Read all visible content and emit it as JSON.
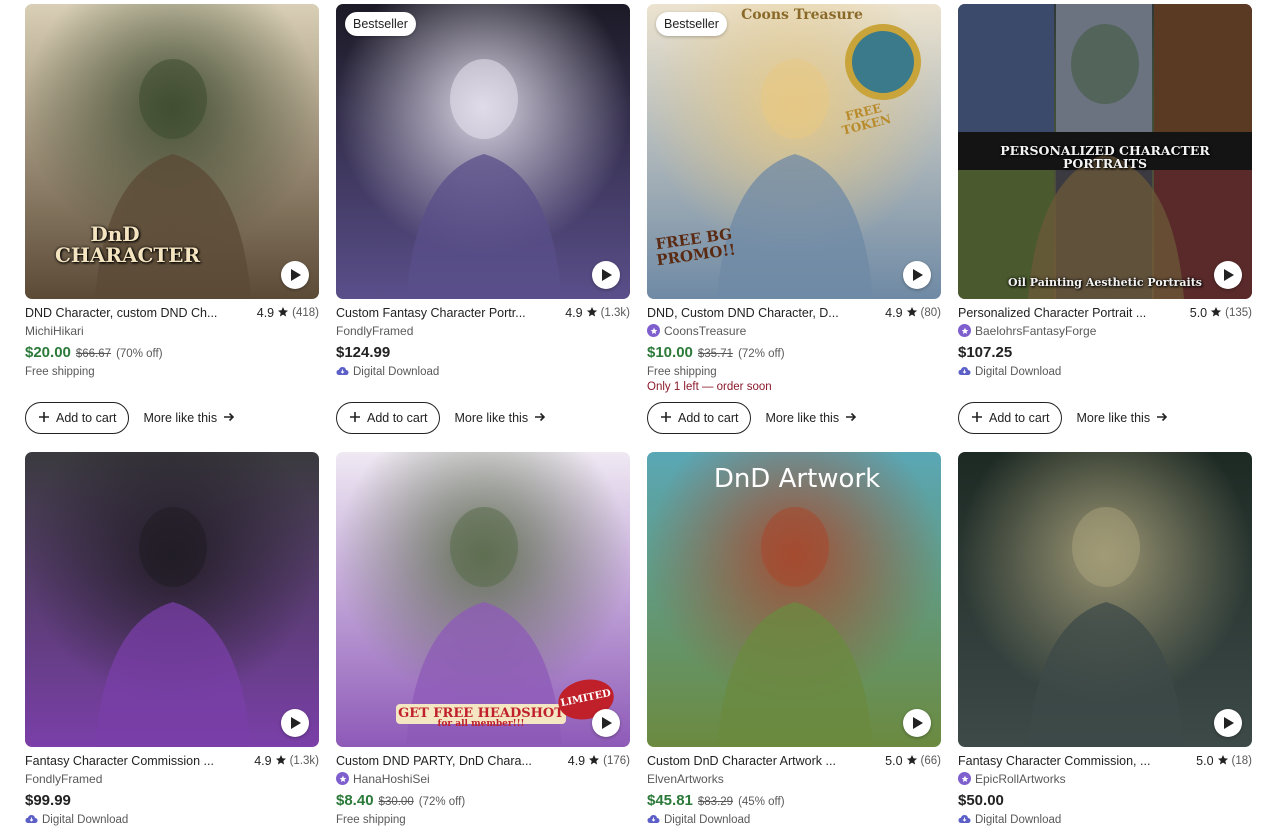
{
  "listings": [
    {
      "title": "DND Character, custom DND Ch...",
      "rating": "4.9",
      "reviews": "(418)",
      "shop": "MichiHikari",
      "star_seller": false,
      "price": "$20.00",
      "original_price": "$66.67",
      "discount": "(70% off)",
      "meta": "Free shipping",
      "scarcity": "",
      "badge": "",
      "overlay_text": "DnD CHARACTER",
      "colors": [
        "#d9cfb6",
        "#5b4a36",
        "#3c4a2e"
      ]
    },
    {
      "title": "Custom Fantasy Character Portr...",
      "rating": "4.9",
      "reviews": "(1.3k)",
      "shop": "FondlyFramed",
      "star_seller": false,
      "price": "$124.99",
      "original_price": "",
      "discount": "",
      "meta": "Digital Download",
      "scarcity": "",
      "badge": "Bestseller",
      "overlay_text": "",
      "colors": [
        "#1c1a26",
        "#5a4f8a",
        "#e8e4f0"
      ]
    },
    {
      "title": "DND, Custom DND Character, D...",
      "rating": "4.9",
      "reviews": "(80)",
      "shop": "CoonsTreasure",
      "star_seller": true,
      "price": "$10.00",
      "original_price": "$35.71",
      "discount": "(72% off)",
      "meta": "Free shipping",
      "scarcity": "Only 1 left — order soon",
      "badge": "Bestseller",
      "overlay_text": "Coons Treasure",
      "overlay_text_2": "FREE TOKEN",
      "overlay_text_3": "FREE BG PROMO!!",
      "colors": [
        "#ece3cf",
        "#6f8aa5",
        "#e8c983"
      ]
    },
    {
      "title": "Personalized Character Portrait ...",
      "rating": "5.0",
      "reviews": "(135)",
      "shop": "BaelohrsFantasyForge",
      "star_seller": true,
      "price": "$107.25",
      "original_price": "",
      "discount": "",
      "meta": "Digital Download",
      "scarcity": "",
      "badge": "",
      "overlay_text": "PERSONALIZED CHARACTER PORTRAITS",
      "overlay_text_2": "Oil Painting Aesthetic Portraits",
      "colors": [
        "#2a2e36",
        "#6e5a3a",
        "#3f5a3b"
      ]
    },
    {
      "title": "Fantasy Character Commission ...",
      "rating": "4.9",
      "reviews": "(1.3k)",
      "shop": "FondlyFramed",
      "star_seller": false,
      "price": "$99.99",
      "original_price": "",
      "discount": "",
      "meta": "Digital Download",
      "scarcity": "",
      "badge": "",
      "overlay_text": "",
      "colors": [
        "#3a3a3e",
        "#7a3fa8",
        "#1f1b22"
      ]
    },
    {
      "title": "Custom DND PARTY, DnD Chara...",
      "rating": "4.9",
      "reviews": "(176)",
      "shop": "HanaHoshiSei",
      "star_seller": true,
      "price": "$8.40",
      "original_price": "$30.00",
      "discount": "(72% off)",
      "meta": "Free shipping",
      "scarcity": "",
      "badge": "",
      "overlay_text": "GET FREE HEADSHOT",
      "overlay_text_2": "for all member!!!",
      "overlay_text_3": "LIMITED",
      "colors": [
        "#efe9f3",
        "#8e5ab8",
        "#5a6b4a"
      ]
    },
    {
      "title": "Custom DnD Character Artwork ...",
      "rating": "5.0",
      "reviews": "(66)",
      "shop": "ElvenArtworks",
      "star_seller": false,
      "price": "$45.81",
      "original_price": "$83.29",
      "discount": "(45% off)",
      "meta": "Digital Download",
      "scarcity": "",
      "badge": "",
      "overlay_text": "DnD Artwork",
      "colors": [
        "#5aa7b5",
        "#6b8a3f",
        "#a8472c"
      ]
    },
    {
      "title": "Fantasy Character Commission, ...",
      "rating": "5.0",
      "reviews": "(18)",
      "shop": "EpicRollArtworks",
      "star_seller": true,
      "price": "$50.00",
      "original_price": "",
      "discount": "",
      "meta": "Digital Download",
      "scarcity": "",
      "badge": "",
      "overlay_text": "",
      "colors": [
        "#1d2a24",
        "#3d4a48",
        "#a8a07a"
      ]
    }
  ],
  "buttons": {
    "add_to_cart": "Add to cart",
    "more_like_this": "More like this"
  }
}
